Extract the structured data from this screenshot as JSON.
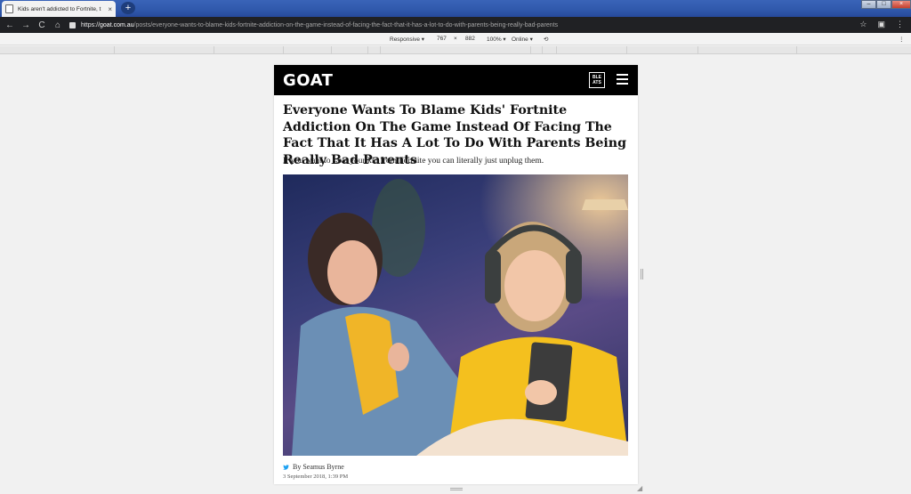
{
  "browser": {
    "tab_title": "Kids aren't addicted to Fortnite, t",
    "tab_close": "×",
    "new_tab": "+",
    "url_scheme": "https://",
    "url_host": "goat.com.au",
    "url_path": "/posts/everyone-wants-to-blame-kids-fortnite-addiction-on-the-game-instead-of-facing-the-fact-that-it-has-a-lot-to-do-with-parents-being-really-bad-parents",
    "nav_back": "←",
    "nav_forward": "→",
    "nav_reload": "C",
    "nav_home": "⌂",
    "star": "☆",
    "menu": "⋮",
    "win_min": "–",
    "win_max": "□",
    "win_close": "×"
  },
  "device_toolbar": {
    "mode": "Responsive ▾",
    "width": "767",
    "times": "×",
    "height": "882",
    "zoom": "100% ▾",
    "network": "Online ▾",
    "rotate": "⟲",
    "more": "⋮"
  },
  "site": {
    "logo": "GOAT",
    "bleats_line1": "BLE",
    "bleats_line2": "ATS"
  },
  "article": {
    "headline": "Everyone Wants To Blame Kids' Fortnite Addiction On The Game Instead Of Facing The Fact That It Has A Lot To Do With Parents Being Really Bad Parents",
    "dek": "If you want to save your kid from Fortnite you can literally just unplug them.",
    "byline": "By Seamus Byrne",
    "date": "3 September 2018, 1:39 PM"
  },
  "colors": {
    "tabstrip": "#2f58ab",
    "toolbar": "#202124",
    "site_header": "#000000",
    "twitter": "#1da1f2"
  }
}
